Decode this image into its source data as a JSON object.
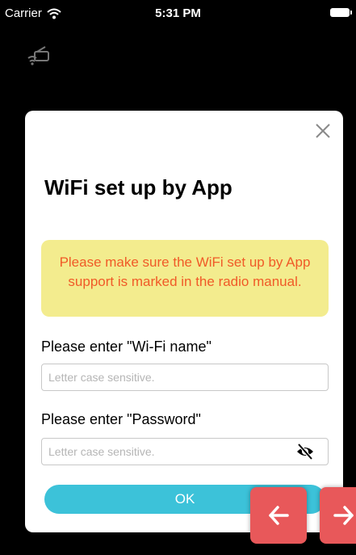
{
  "status_bar": {
    "carrier": "Carrier",
    "time": "5:31 PM"
  },
  "icons": {
    "status_wifi": "wifi-icon",
    "battery": "battery-icon",
    "radio": "radio-wifi-icon",
    "close": "close-icon",
    "password_visibility": "eye-slash-icon",
    "prev": "arrow-left-icon",
    "next": "arrow-right-icon"
  },
  "dialog": {
    "title": "WiFi set up by App",
    "notice": "Please make sure the WiFi set up by App support is marked in the radio manual.",
    "wifi_label": "Please enter \"Wi-Fi name\"",
    "wifi_placeholder": "Letter case sensitive.",
    "wifi_value": "",
    "password_label": "Please enter \"Password\"",
    "password_placeholder": "Letter case sensitive.",
    "password_value": "",
    "ok_label": "OK"
  },
  "colors": {
    "notice_background": "#f3ec8e",
    "notice_text": "#f05a28",
    "ok_button": "#3cc2d9",
    "nav_button": "#e8585a"
  }
}
